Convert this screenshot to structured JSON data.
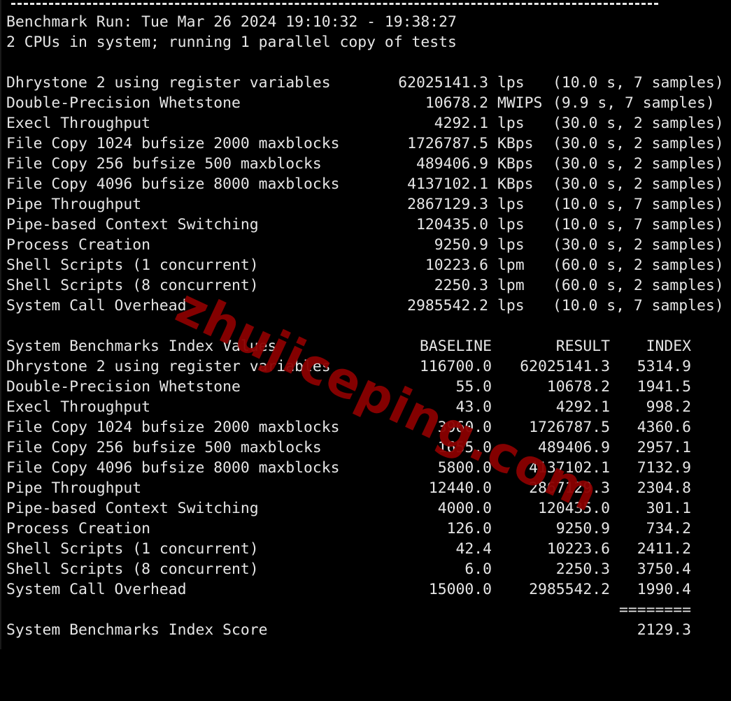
{
  "terminal": {
    "header": {
      "run_line": "Benchmark Run: Tue Mar 26 2024 19:10:32 - 19:38:27",
      "cpu_line": "2 CPUs in system; running 1 parallel copy of tests"
    },
    "raw_results": [
      {
        "name": "Dhrystone 2 using register variables",
        "value": "62025141.3",
        "unit": "lps",
        "detail": "(10.0 s, 7 samples)"
      },
      {
        "name": "Double-Precision Whetstone",
        "value": "10678.2",
        "unit": "MWIPS",
        "detail": "(9.9 s, 7 samples)"
      },
      {
        "name": "Execl Throughput",
        "value": "4292.1",
        "unit": "lps",
        "detail": "(30.0 s, 2 samples)"
      },
      {
        "name": "File Copy 1024 bufsize 2000 maxblocks",
        "value": "1726787.5",
        "unit": "KBps",
        "detail": "(30.0 s, 2 samples)"
      },
      {
        "name": "File Copy 256 bufsize 500 maxblocks",
        "value": "489406.9",
        "unit": "KBps",
        "detail": "(30.0 s, 2 samples)"
      },
      {
        "name": "File Copy 4096 bufsize 8000 maxblocks",
        "value": "4137102.1",
        "unit": "KBps",
        "detail": "(30.0 s, 2 samples)"
      },
      {
        "name": "Pipe Throughput",
        "value": "2867129.3",
        "unit": "lps",
        "detail": "(10.0 s, 7 samples)"
      },
      {
        "name": "Pipe-based Context Switching",
        "value": "120435.0",
        "unit": "lps",
        "detail": "(10.0 s, 7 samples)"
      },
      {
        "name": "Process Creation",
        "value": "9250.9",
        "unit": "lps",
        "detail": "(30.0 s, 2 samples)"
      },
      {
        "name": "Shell Scripts (1 concurrent)",
        "value": "10223.6",
        "unit": "lpm",
        "detail": "(60.0 s, 2 samples)"
      },
      {
        "name": "Shell Scripts (8 concurrent)",
        "value": "2250.3",
        "unit": "lpm",
        "detail": "(60.0 s, 2 samples)"
      },
      {
        "name": "System Call Overhead",
        "value": "2985542.2",
        "unit": "lps",
        "detail": "(10.0 s, 7 samples)"
      }
    ],
    "index_table": {
      "title": "System Benchmarks Index Values",
      "headers": [
        "BASELINE",
        "RESULT",
        "INDEX"
      ],
      "rows": [
        {
          "name": "Dhrystone 2 using register variables",
          "baseline": "116700.0",
          "result": "62025141.3",
          "index": "5314.9"
        },
        {
          "name": "Double-Precision Whetstone",
          "baseline": "55.0",
          "result": "10678.2",
          "index": "1941.5"
        },
        {
          "name": "Execl Throughput",
          "baseline": "43.0",
          "result": "4292.1",
          "index": "998.2"
        },
        {
          "name": "File Copy 1024 bufsize 2000 maxblocks",
          "baseline": "3960.0",
          "result": "1726787.5",
          "index": "4360.6"
        },
        {
          "name": "File Copy 256 bufsize 500 maxblocks",
          "baseline": "1655.0",
          "result": "489406.9",
          "index": "2957.1"
        },
        {
          "name": "File Copy 4096 bufsize 8000 maxblocks",
          "baseline": "5800.0",
          "result": "4137102.1",
          "index": "7132.9"
        },
        {
          "name": "Pipe Throughput",
          "baseline": "12440.0",
          "result": "2867129.3",
          "index": "2304.8"
        },
        {
          "name": "Pipe-based Context Switching",
          "baseline": "4000.0",
          "result": "120435.0",
          "index": "301.1"
        },
        {
          "name": "Process Creation",
          "baseline": "126.0",
          "result": "9250.9",
          "index": "734.2"
        },
        {
          "name": "Shell Scripts (1 concurrent)",
          "baseline": "42.4",
          "result": "10223.6",
          "index": "2411.2"
        },
        {
          "name": "Shell Scripts (8 concurrent)",
          "baseline": "6.0",
          "result": "2250.3",
          "index": "3750.4"
        },
        {
          "name": "System Call Overhead",
          "baseline": "15000.0",
          "result": "2985542.2",
          "index": "1990.4"
        }
      ],
      "separator": "========",
      "score_label": "System Benchmarks Index Score",
      "score": "2129.3"
    }
  },
  "watermark": "zhujiceping.com"
}
